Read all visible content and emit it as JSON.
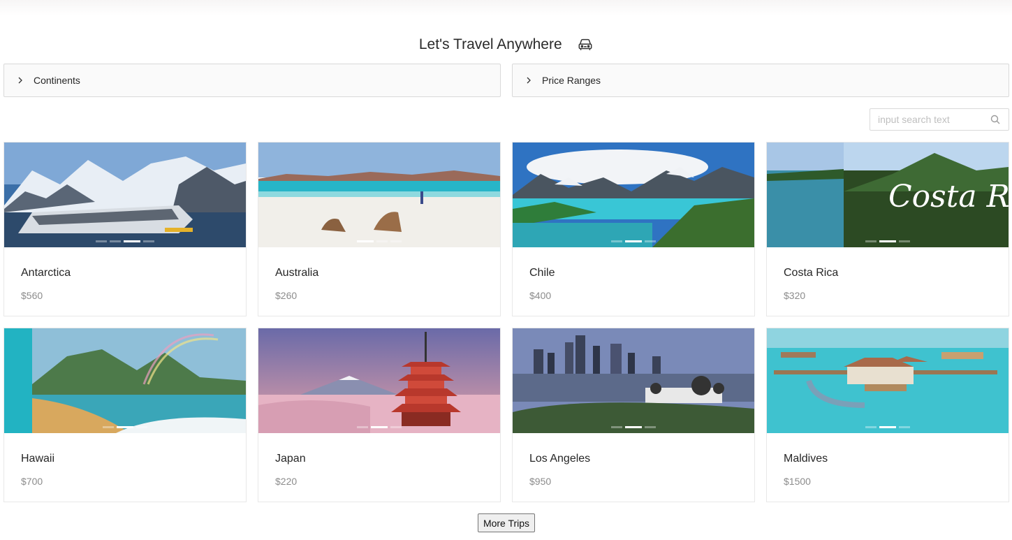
{
  "header": {
    "title": "Let's Travel Anywhere",
    "icon": "car-icon"
  },
  "filters": {
    "continents_label": "Continents",
    "price_ranges_label": "Price Ranges"
  },
  "search": {
    "placeholder": "input search text",
    "value": ""
  },
  "trips": [
    {
      "name": "Antarctica",
      "price": "$560",
      "carousel_slides": 4,
      "active_slide": 3
    },
    {
      "name": "Australia",
      "price": "$260",
      "carousel_slides": 3,
      "active_slide": 1
    },
    {
      "name": "Chile",
      "price": "$400",
      "carousel_slides": 3,
      "active_slide": 2
    },
    {
      "name": "Costa Rica",
      "price": "$320",
      "carousel_slides": 3,
      "active_slide": 2,
      "image_caption": "Costa Ri"
    },
    {
      "name": "Hawaii",
      "price": "$700",
      "carousel_slides": 3,
      "active_slide": 2
    },
    {
      "name": "Japan",
      "price": "$220",
      "carousel_slides": 3,
      "active_slide": 2
    },
    {
      "name": "Los Angeles",
      "price": "$950",
      "carousel_slides": 3,
      "active_slide": 2
    },
    {
      "name": "Maldives",
      "price": "$1500",
      "carousel_slides": 3,
      "active_slide": 2
    }
  ],
  "more_button": "More Trips",
  "colors": {
    "border": "#d9d9d9",
    "panel_bg": "#fafafa",
    "price": "#8c8c8c"
  }
}
